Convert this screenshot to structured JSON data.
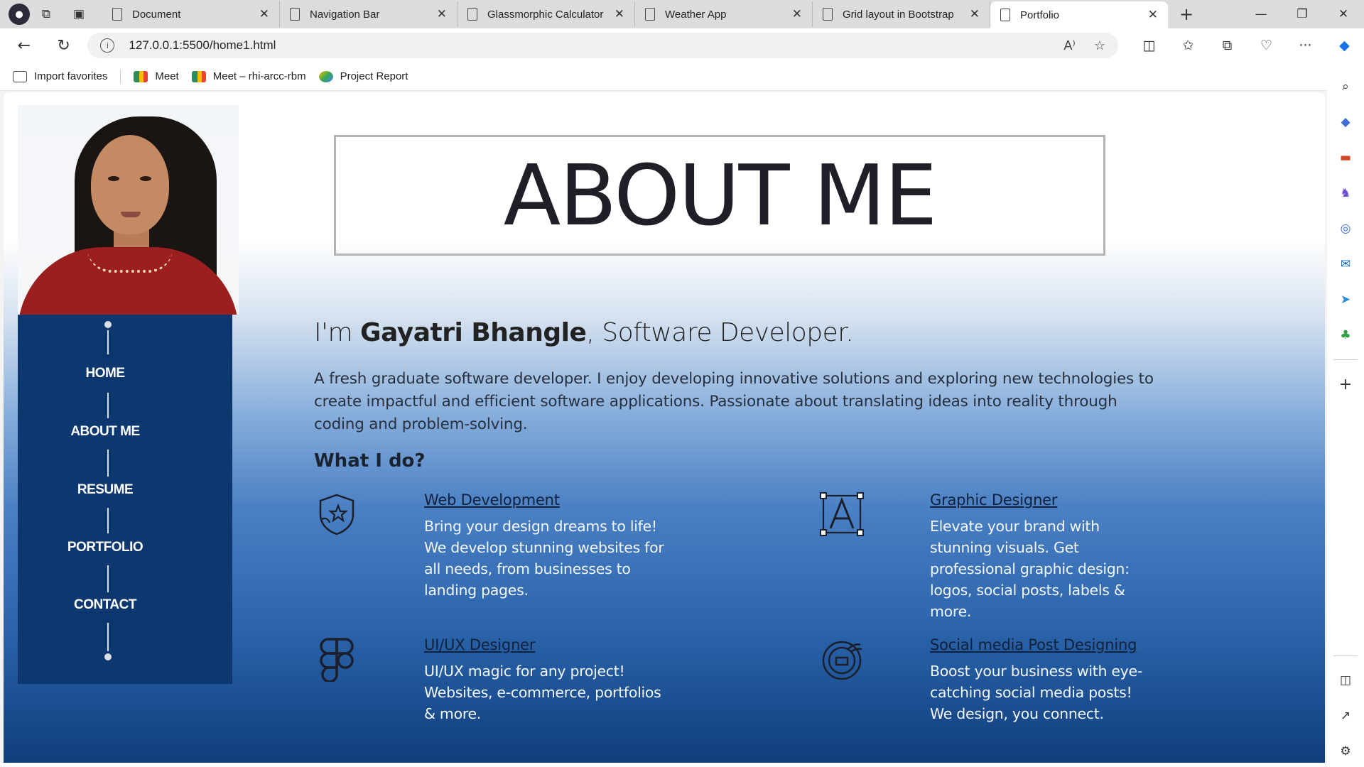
{
  "browser": {
    "tabs": [
      {
        "title": "Document"
      },
      {
        "title": "Navigation Bar"
      },
      {
        "title": "Glassmorphic Calculator"
      },
      {
        "title": "Weather App"
      },
      {
        "title": "Grid layout in Bootstrap"
      },
      {
        "title": "Portfolio",
        "active": true
      }
    ],
    "url": "127.0.0.1:5500/home1.html",
    "favorites": [
      {
        "label": "Import favorites"
      },
      {
        "label": "Meet"
      },
      {
        "label": "Meet – rhi-arcc-rbm"
      },
      {
        "label": "Project Report"
      }
    ]
  },
  "sidebar": {
    "items": [
      {
        "label": "HOME"
      },
      {
        "label": "ABOUT ME"
      },
      {
        "label": "RESUME"
      },
      {
        "label": "PORTFOLIO"
      },
      {
        "label": "CONTACT"
      }
    ],
    "bg_color": "#0d376f"
  },
  "main": {
    "title": "ABOUT ME",
    "intro_prefix": "I'm ",
    "name": "Gayatri Bhangle",
    "intro_suffix": ", Software Developer.",
    "description": "A fresh graduate software developer. I enjoy developing innovative solutions and exploring new technologies to create impactful and efficient software applications. Passionate about translating ideas into reality through coding and problem-solving.",
    "what_i_do": "What I do?",
    "services": [
      {
        "title": "Web Development",
        "text": "Bring your design dreams to life! We develop stunning websites for all needs, from businesses to landing pages.",
        "icon": "shield-star-icon"
      },
      {
        "title": "Graphic Designer",
        "text": "Elevate your brand with stunning visuals. Get professional graphic design: logos, social posts, labels & more.",
        "icon": "typography-a-icon"
      },
      {
        "title": "UI/UX Designer",
        "text": "UI/UX magic for any project! Websites, e-commerce, portfolios & more.",
        "icon": "figma-icon"
      },
      {
        "title": "Social media Post Designing",
        "text": "Boost your business with eye-catching social media posts! We design, you connect.",
        "icon": "social-post-icon"
      }
    ]
  }
}
